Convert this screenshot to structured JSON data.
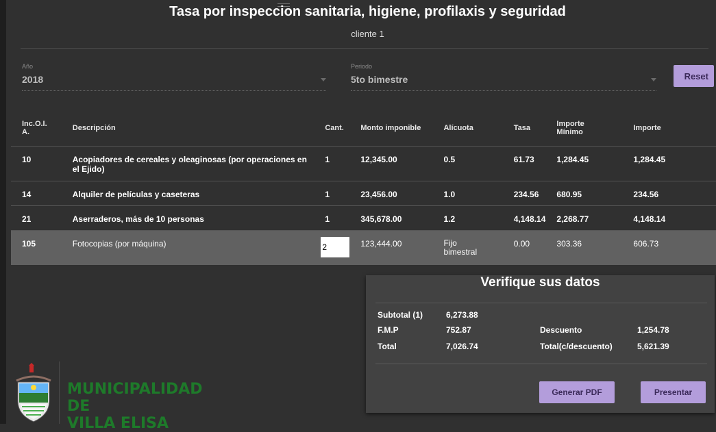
{
  "header": {
    "title": "Tasa por inspeccion sanitaria, higiene, profilaxis y seguridad",
    "subtitle": "cliente 1"
  },
  "filters": {
    "year": {
      "label": "Año",
      "value": "2018"
    },
    "period": {
      "label": "Periodo",
      "value": "5to bimestre"
    },
    "reset_label": "Reset"
  },
  "table": {
    "headers": {
      "code": "Inc.O.I. A.",
      "description": "Descripción",
      "qty": "Cant.",
      "taxable": "Monto imponible",
      "rate": "Alícuota",
      "fee": "Tasa",
      "min_line1": "Importe",
      "min_line2": "Mínimo",
      "amount": "Importe"
    },
    "rows": [
      {
        "code": "10",
        "description": "Acopiadores de cereales y oleaginosas (por operaciones en el Ejido)",
        "qty": "1",
        "taxable": "12,345.00",
        "rate": "0.5",
        "fee": "61.73",
        "min": "1,284.45",
        "amount": "1,284.45"
      },
      {
        "code": "14",
        "description": "Alquiler de películas y caseteras",
        "qty": "1",
        "taxable": "23,456.00",
        "rate": "1.0",
        "fee": "234.56",
        "min": "680.95",
        "amount": "234.56"
      },
      {
        "code": "21",
        "description": "Aserraderos, más de 10 personas",
        "qty": "1",
        "taxable": "345,678.00",
        "rate": "1.2",
        "fee": "4,148.14",
        "min": "2,268.77",
        "amount": "4,148.14"
      },
      {
        "code": "105",
        "description": "Fotocopias (por máquina)",
        "qty": "2",
        "taxable": "123,444.00",
        "rate_line1": "Fijo",
        "rate_line2": "bimestral",
        "fee": "0.00",
        "min": "303.36",
        "amount": "606.73"
      }
    ]
  },
  "summary": {
    "title": "Verifique sus datos",
    "subtotal_label": "Subtotal (1)",
    "subtotal_value": "6,273.88",
    "fmp_label": "F.M.P",
    "fmp_value": "752.87",
    "total_label": "Total",
    "total_value": "7,026.74",
    "discount_label": "Descuento",
    "discount_value": "1,254.78",
    "total_disc_label": "Total(c/descuento)",
    "total_disc_value": "5,621.39",
    "pdf_button": "Generar PDF",
    "submit_button": "Presentar"
  },
  "logo": {
    "line1": "MUNICIPALIDAD DE",
    "line2": "VILLA ELISA"
  },
  "colors": {
    "background": "#303030",
    "accent": "#b39ddb",
    "selected_row": "#616161",
    "panel": "#424242",
    "logo_green": "#1e7a2a"
  }
}
